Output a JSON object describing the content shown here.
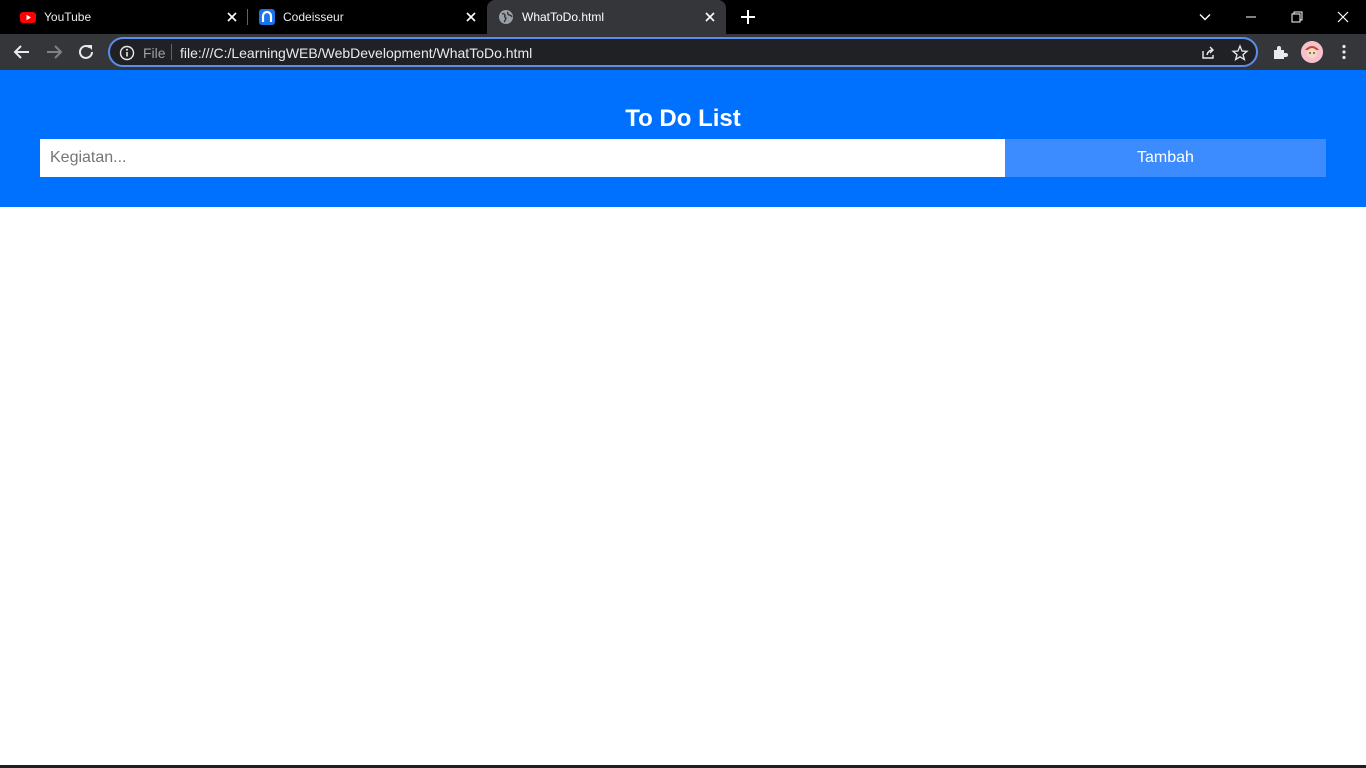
{
  "browser": {
    "tabs": [
      {
        "title": "YouTube",
        "icon": "youtube-icon",
        "active": false
      },
      {
        "title": "Codeisseur",
        "icon": "codeisseur-icon",
        "active": false
      },
      {
        "title": "WhatToDo.html",
        "icon": "globe-icon",
        "active": true
      }
    ],
    "omnibox": {
      "scheme_label": "File",
      "url": "file:///C:/LearningWEB/WebDevelopment/WhatToDo.html"
    }
  },
  "page": {
    "title": "To Do List",
    "input_placeholder": "Kegiatan...",
    "input_value": "",
    "add_button_label": "Tambah"
  },
  "colors": {
    "header_bg": "#0070ff",
    "button_bg": "#3c8cff",
    "tabstrip_bg": "#000000",
    "toolbar_bg": "#35363a",
    "omnibox_border": "#5b8def"
  }
}
